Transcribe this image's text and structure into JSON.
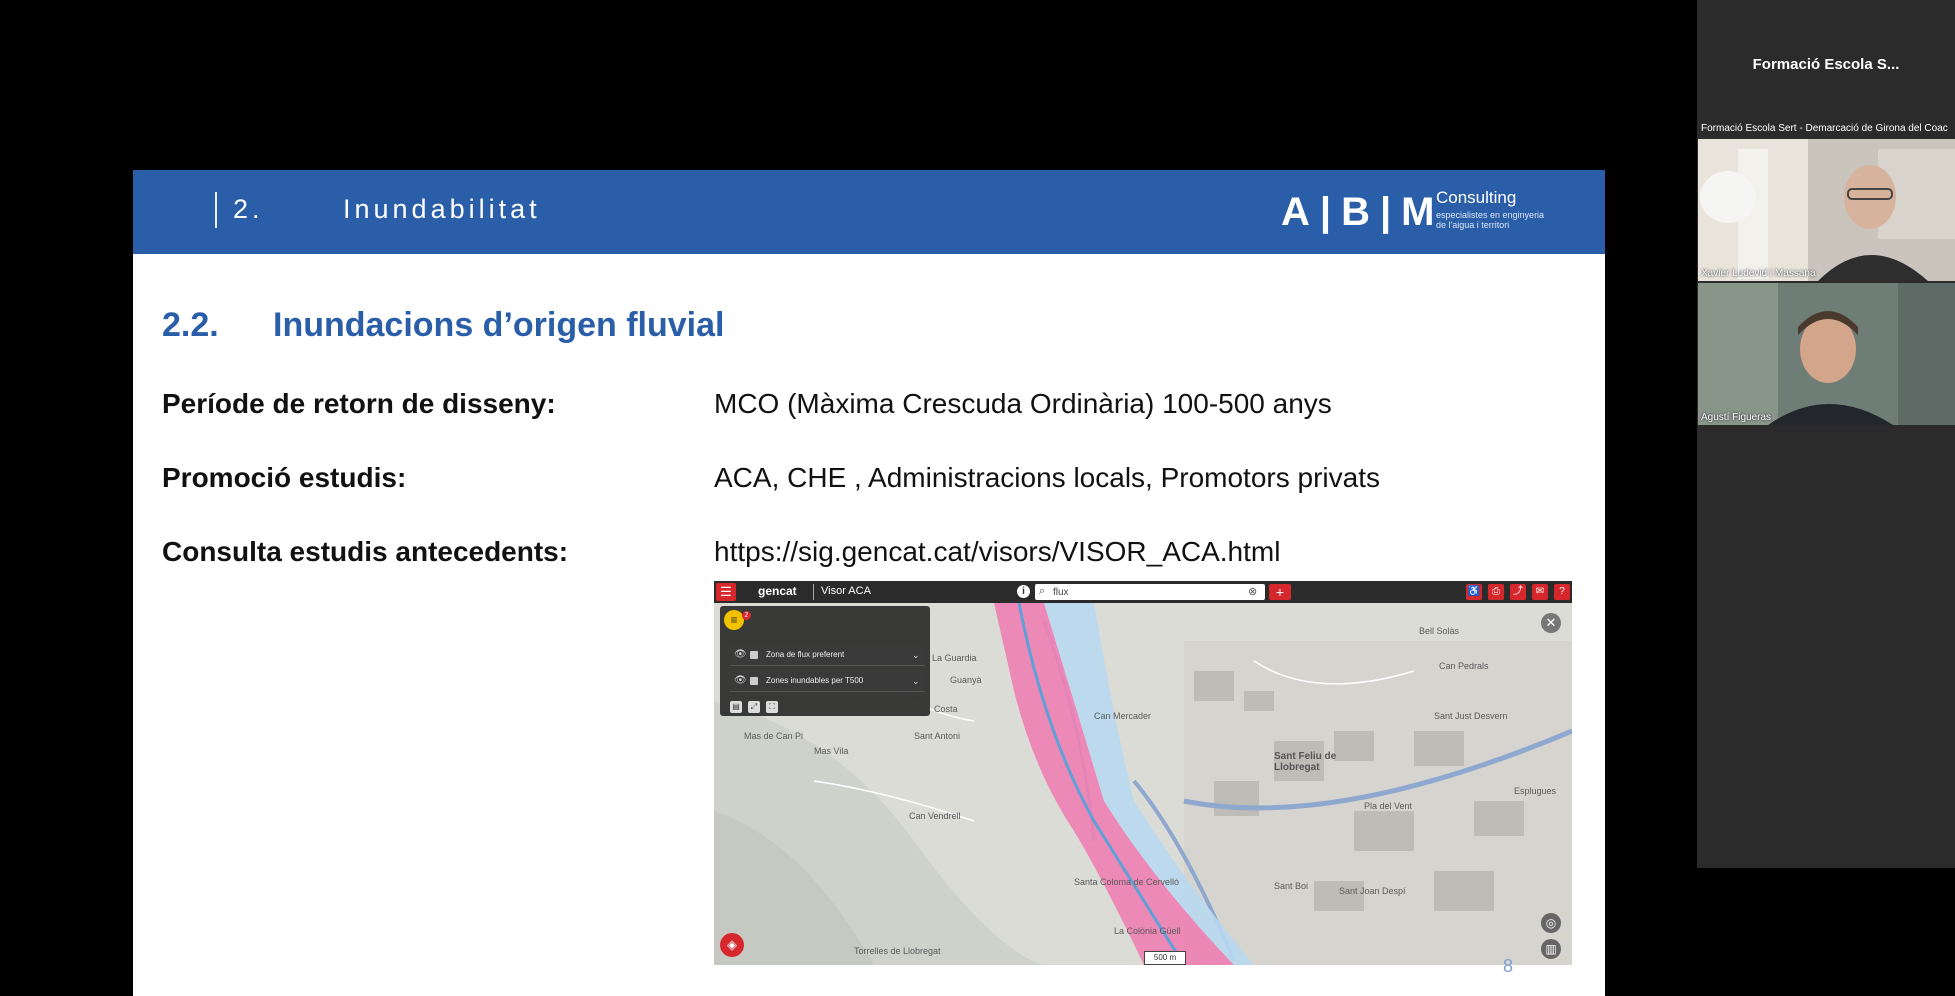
{
  "slide": {
    "section_number": "2.",
    "section_title": "Inundabilitat",
    "logo": {
      "letters": "A|B|M",
      "brand": "Consulting",
      "tagline": "especialistes en enginyeria de l'aigua i territori"
    },
    "subsection_number": "2.2.",
    "subsection_title": "Inundacions d’origen fluvial",
    "rows": [
      {
        "label": "Període de retorn de disseny:",
        "value": "MCO (Màxima Crescuda Ordinària) 100-500 anys"
      },
      {
        "label": "Promoció estudis:",
        "value": "ACA, CHE , Administracions locals, Promotors privats"
      },
      {
        "label": "Consulta estudis antecedents:",
        "value": "https://sig.gencat.cat/visors/VISOR_ACA.html"
      }
    ],
    "page_number": "8"
  },
  "map_viewer": {
    "brand": "gencat",
    "title": "Visor ACA",
    "search_value": "flux",
    "layers_count": "2",
    "layers": [
      {
        "name": "Zona de flux preferent"
      },
      {
        "name": "Zones inundables per T500"
      }
    ],
    "scale": "500 m",
    "place_labels": [
      "La Guardia",
      "Guanyà",
      "Costa",
      "Mas de Can Pi",
      "Mas Vila",
      "Sant Antoni",
      "Can Vendrell",
      "Sant Feliu de Llobregat",
      "Sant Just Desvern",
      "Can Mercader",
      "La Colònia Güell",
      "Santa Coloma de Cervelló",
      "Torrelles de Llobregat",
      "Sant Boi",
      "Bell Solàs",
      "Can Pedrals",
      "Pla del Vent",
      "Sant Joan Despí",
      "Esplugues"
    ]
  },
  "call": {
    "meeting_title": "Formació Escola S...",
    "shared_by": "Formació Escola Sert - Demarcació de Girona del Coac",
    "participants": [
      {
        "name": "Xavier Ludevid i Massana"
      },
      {
        "name": "Agustí Figueras"
      }
    ]
  },
  "colors": {
    "header_blue": "#2a5ea8",
    "gencat_red": "#d6282c",
    "flood_pink": "#f07ab0"
  }
}
